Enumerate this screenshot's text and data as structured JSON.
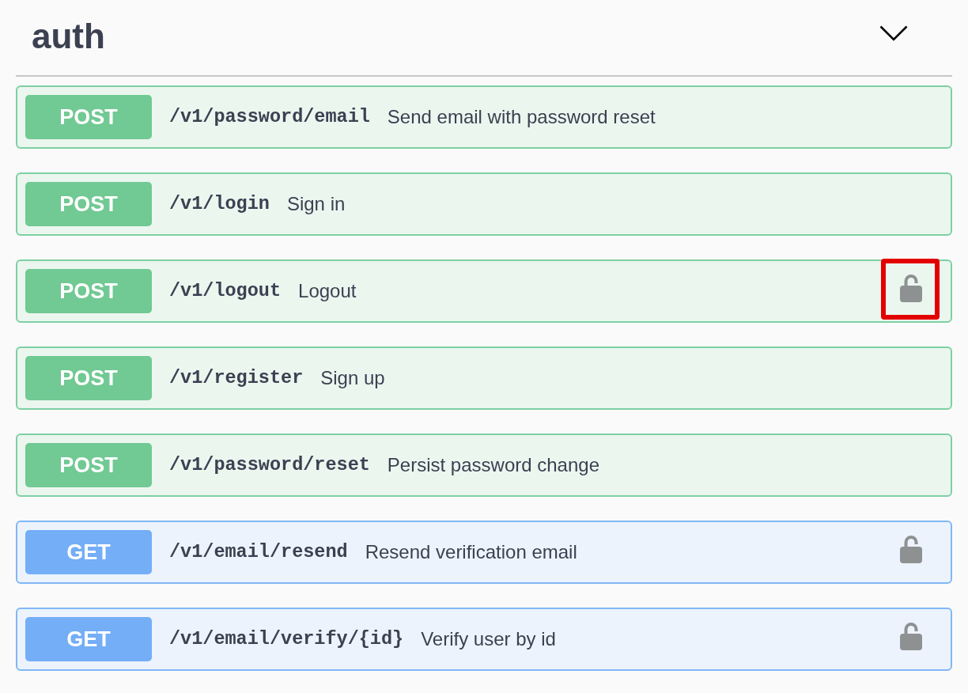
{
  "section": {
    "title": "auth",
    "expanded": true
  },
  "operations": [
    {
      "kind": "post",
      "method": "POST",
      "path": "/v1/password/email",
      "summary": "Send email with password reset",
      "secured": false,
      "highlighted": false
    },
    {
      "kind": "post",
      "method": "POST",
      "path": "/v1/login",
      "summary": "Sign in",
      "secured": false,
      "highlighted": false
    },
    {
      "kind": "post",
      "method": "POST",
      "path": "/v1/logout",
      "summary": "Logout",
      "secured": true,
      "locked": false,
      "highlighted": true
    },
    {
      "kind": "post",
      "method": "POST",
      "path": "/v1/register",
      "summary": "Sign up",
      "secured": false,
      "highlighted": false
    },
    {
      "kind": "post",
      "method": "POST",
      "path": "/v1/password/reset",
      "summary": "Persist password change",
      "secured": false,
      "highlighted": false
    },
    {
      "kind": "get",
      "method": "GET",
      "path": "/v1/email/resend",
      "summary": "Resend verification email",
      "secured": true,
      "locked": false,
      "highlighted": false
    },
    {
      "kind": "get",
      "method": "GET",
      "path": "/v1/email/verify/{id}",
      "summary": "Verify user by id",
      "secured": true,
      "locked": false,
      "highlighted": false
    }
  ]
}
